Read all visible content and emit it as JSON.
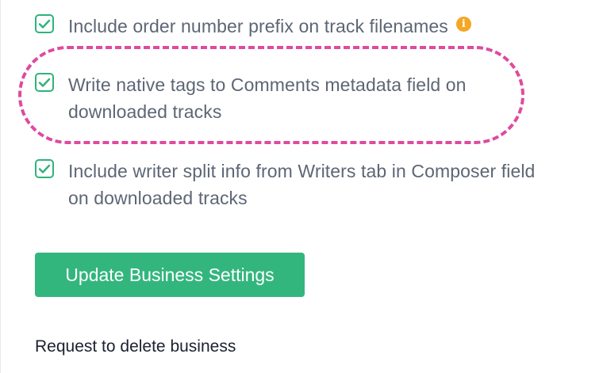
{
  "settings": {
    "options": [
      {
        "label": "Include order number prefix on track filenames",
        "checked": true,
        "info_icon": "info-icon"
      },
      {
        "label": "Write native tags to Comments metadata field on downloaded tracks",
        "checked": true,
        "highlighted": true
      },
      {
        "label": "Include writer split info from Writers tab in Composer field on downloaded tracks",
        "checked": true
      }
    ],
    "info_glyph": "i",
    "update_button_label": "Update Business Settings",
    "delete_link_label": "Request to delete business"
  },
  "colors": {
    "accent_green": "#33b67e",
    "highlight_pink": "#df4a9e",
    "info_orange": "#f5a623",
    "label_gray": "#5d6675"
  }
}
